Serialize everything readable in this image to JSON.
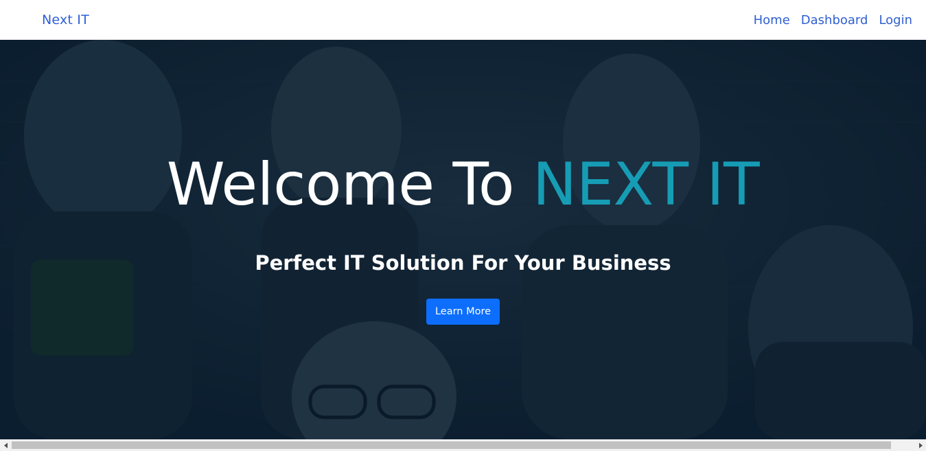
{
  "navbar": {
    "brand": "Next IT",
    "links": [
      {
        "label": "Home"
      },
      {
        "label": "Dashboard"
      },
      {
        "label": "Login"
      }
    ]
  },
  "hero": {
    "title_prefix": "Welcome To ",
    "title_accent": "NEXT IT",
    "subtitle": "Perfect IT Solution For Your Business",
    "button_label": "Learn More"
  },
  "colors": {
    "brand": "#2d5fd9",
    "accent": "#169db5",
    "button": "#0d6efd",
    "hero_overlay": "#0a1c2c"
  },
  "scrollbar": {
    "left_icon": "chevron-left-icon",
    "right_icon": "chevron-right-icon"
  }
}
